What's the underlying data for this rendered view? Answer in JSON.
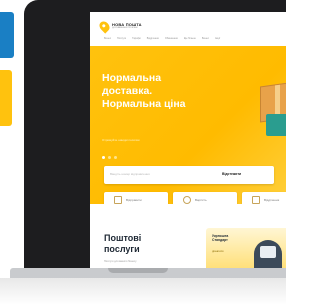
{
  "site": {
    "logo_name": "НОВА ПОШТА",
    "logo_tagline": "ДОСТАВКА БЕЗ ПРОБЛЕМ",
    "nav": [
      "Бізнес",
      "Послуги",
      "Тарифи",
      "Відділення",
      "Обмеження",
      "Ще більше",
      "Бізнес",
      "Акції"
    ]
  },
  "hero": {
    "title": "Нормальна доставка. Нормальна ціна",
    "subtitle": "Отримуйте швидкі посилки",
    "slides": 3,
    "active_slide": 1
  },
  "tracking": {
    "placeholder": "Введіть номер відправлення",
    "button_label": "Відстежити"
  },
  "services": [
    {
      "icon": "package-icon",
      "label": "Відправити"
    },
    {
      "icon": "clock-icon",
      "label": "Вартість"
    },
    {
      "icon": "location-icon",
      "label": "Відділення"
    }
  ],
  "section": {
    "title": "Поштові послуги",
    "subtitle": "Послуги для вашого бізнесу"
  },
  "promo": {
    "title": "Укрпошта Стандарт",
    "badge": "дізнатися"
  },
  "colors": {
    "brand_yellow": "#ffc20e",
    "accent_blue": "#1a7fc4",
    "text_dark": "#1d2733"
  }
}
